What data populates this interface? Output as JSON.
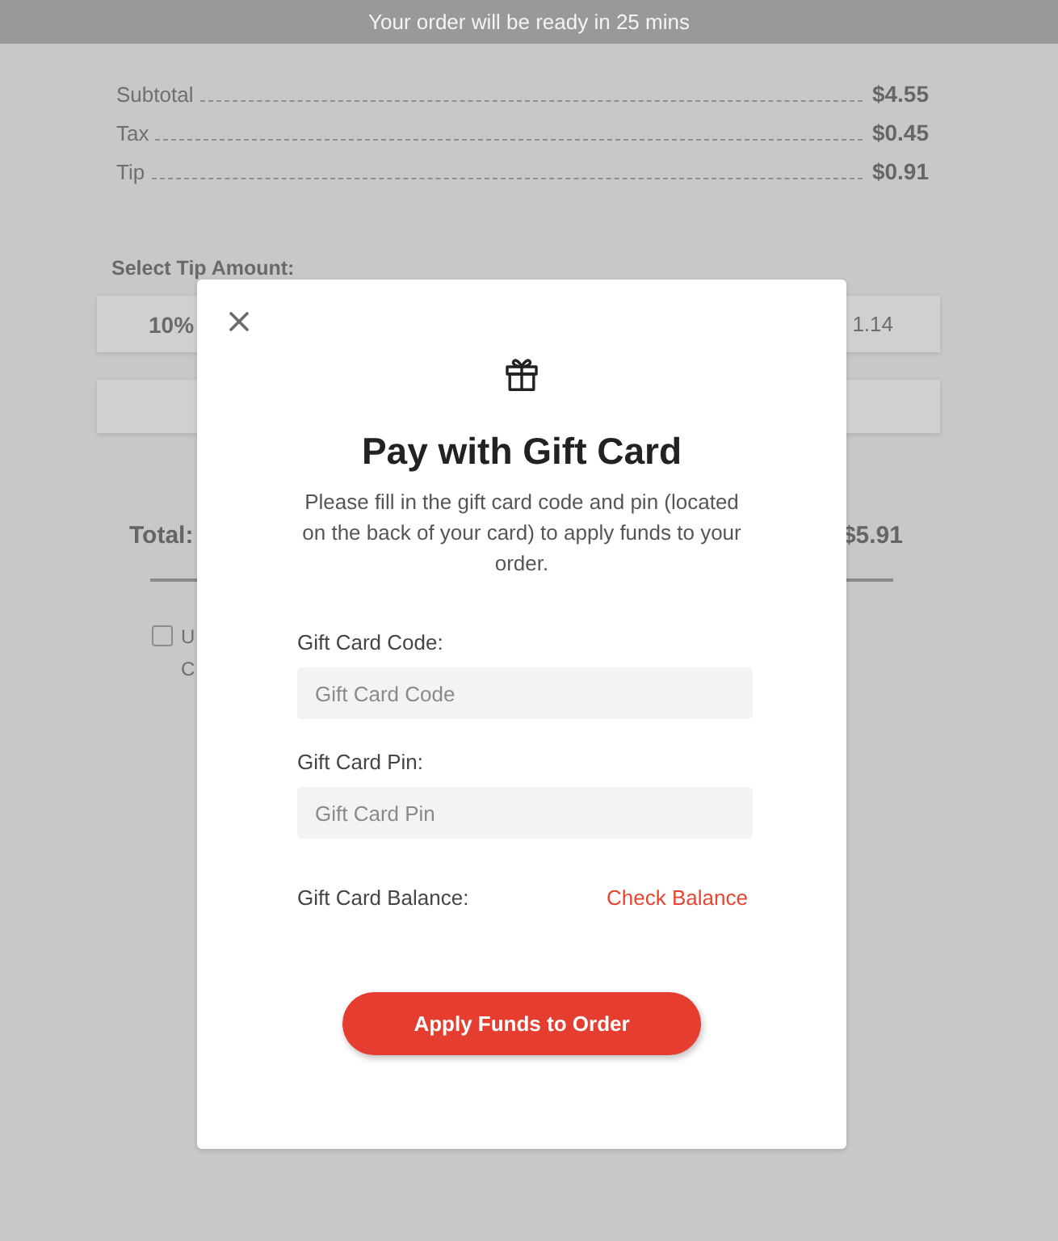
{
  "banner": {
    "text": "Your order will be ready in 25 mins"
  },
  "summary": [
    {
      "label": "Subtotal",
      "value": "$4.55"
    },
    {
      "label": "Tax",
      "value": "$0.45"
    },
    {
      "label": "Tip",
      "value": "$0.91"
    }
  ],
  "tip": {
    "heading": "Select Tip Amount:",
    "option": "10%",
    "amount": "1.14"
  },
  "total": {
    "label": "Total:",
    "value": "$5.91"
  },
  "checkbox": {
    "checked": false,
    "label": "U",
    "note": "C"
  },
  "modal": {
    "title": "Pay with Gift Card",
    "description": "Please fill in the gift card code and pin (located on the back of your card) to apply funds to your order.",
    "fields": [
      {
        "label": "Gift Card Code:",
        "placeholder": "Gift Card Code"
      },
      {
        "label": "Gift Card Pin:",
        "placeholder": "Gift Card Pin"
      }
    ],
    "balance": {
      "label": "Gift Card Balance:",
      "link": "Check Balance"
    },
    "button": "Apply Funds to Order"
  }
}
